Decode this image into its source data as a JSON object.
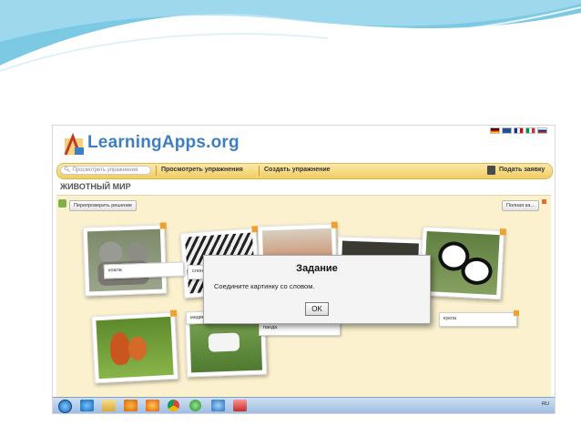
{
  "app": {
    "logo_text": "LearningApps.org",
    "flags": [
      "de",
      "gb",
      "fr",
      "it",
      "ru"
    ]
  },
  "navbar": {
    "search_placeholder": "Просмотреть упражнения",
    "links": [
      "Просмотреть упражнения",
      "Создать упражнение"
    ],
    "report_label": "Подать заявку"
  },
  "page_title": "ЖИВОТНЫЙ МИР",
  "board": {
    "check_button": "Перепроверить решение",
    "fullscreen_button": "Полная ка...",
    "word_cards": [
      "коала",
      "слон",
      "медведь",
      "панда",
      "кукла"
    ],
    "word_partial": "коала"
  },
  "modal": {
    "title": "Задание",
    "text": "Соедините картинку со словом.",
    "ok_label": "OK"
  },
  "taskbar": {
    "tray_text": "RU"
  },
  "colors": {
    "accent": "#3d7fc2",
    "navbar": "#f2cd62",
    "board": "#fbf1cf",
    "pin": "#f0a030"
  }
}
